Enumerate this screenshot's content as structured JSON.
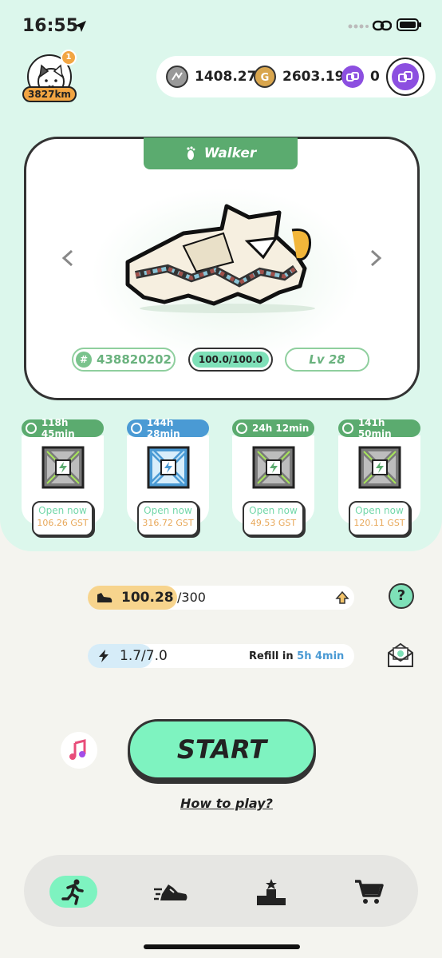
{
  "status_bar": {
    "time": "16:55"
  },
  "profile": {
    "badge": "1",
    "distance": "3827km"
  },
  "balances": {
    "gmt": "1408.27",
    "gst": "2603.19",
    "sol": "0"
  },
  "sneaker": {
    "type": "Walker",
    "id": "438820202",
    "durability": "100.0/100.0",
    "level": "Lv 28"
  },
  "mystery_boxes": [
    {
      "timer": "118h 45min",
      "open_label": "Open now",
      "cost": "106.26 GST",
      "color": "#5bab6f",
      "variant": "green"
    },
    {
      "timer": "144h 28min",
      "open_label": "Open now",
      "cost": "316.72 GST",
      "color": "#4a9ad4",
      "variant": "blue"
    },
    {
      "timer": "24h 12min",
      "open_label": "Open now",
      "cost": "49.53 GST",
      "color": "#5bab6f",
      "variant": "green"
    },
    {
      "timer": "141h 50min",
      "open_label": "Open now",
      "cost": "120.11 GST",
      "color": "#5bab6f",
      "variant": "green"
    }
  ],
  "durability_bar": {
    "value": "100.28",
    "max": "/300",
    "fraction": 0.334
  },
  "energy_bar": {
    "value": "1.7/7.0",
    "fraction": 0.243,
    "refill_label": "Refill in",
    "refill_time": "5h 4min"
  },
  "help_label": "?",
  "start_label": "START",
  "how_to_play": "How to play?",
  "nav": [
    {
      "name": "run",
      "icon": "running-man-icon",
      "active": true
    },
    {
      "name": "sneakers",
      "icon": "sneaker-icon",
      "active": false
    },
    {
      "name": "leaderboard",
      "icon": "podium-icon",
      "active": false
    },
    {
      "name": "market",
      "icon": "cart-icon",
      "active": false
    }
  ]
}
